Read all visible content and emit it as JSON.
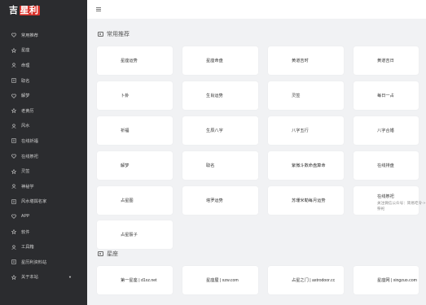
{
  "logo": {
    "text": "吉",
    "highlight": "星利"
  },
  "sidebar": {
    "items": [
      {
        "label": "常用推荐",
        "icon": "heart-icon"
      },
      {
        "label": "星座",
        "icon": "star-icon"
      },
      {
        "label": "命理",
        "icon": "user-icon"
      },
      {
        "label": "取名",
        "icon": "book-icon"
      },
      {
        "label": "解梦",
        "icon": "heart-icon"
      },
      {
        "label": "老黄历",
        "icon": "star-icon"
      },
      {
        "label": "风水",
        "icon": "user-icon"
      },
      {
        "label": "在线祈福",
        "icon": "book-icon"
      },
      {
        "label": "在线祭祀",
        "icon": "heart-icon"
      },
      {
        "label": "灵签",
        "icon": "star-icon"
      },
      {
        "label": "神秘学",
        "icon": "user-icon"
      },
      {
        "label": "风水堪舆名家",
        "icon": "book-icon"
      },
      {
        "label": "APP",
        "icon": "heart-icon"
      },
      {
        "label": "软件",
        "icon": "star-icon"
      },
      {
        "label": "工具箱",
        "icon": "user-icon"
      },
      {
        "label": "星历利资料站",
        "icon": "book-icon"
      },
      {
        "label": "关于本站",
        "icon": "star-icon",
        "caret": "▼"
      }
    ]
  },
  "sections": [
    {
      "title": "常用推荐",
      "cards": [
        {
          "title": "星座运势"
        },
        {
          "title": "星座命盘"
        },
        {
          "title": "黄道吉时"
        },
        {
          "title": "黄道吉日"
        },
        {
          "title": "卜卦"
        },
        {
          "title": "生肖运势"
        },
        {
          "title": "灵签"
        },
        {
          "title": "每日一占"
        },
        {
          "title": "祈福"
        },
        {
          "title": "生辰八字"
        },
        {
          "title": "八字五行"
        },
        {
          "title": "八字合婚"
        },
        {
          "title": "解梦"
        },
        {
          "title": "取名"
        },
        {
          "title": "紫微斗数命盘算命"
        },
        {
          "title": "在线排盘"
        },
        {
          "title": "占星图"
        },
        {
          "title": "塔罗运势"
        },
        {
          "title": "苏珊米勒每月运势"
        },
        {
          "title": "在线祭祀",
          "desc": "关注微信公众号：简易吃令->祭祀"
        },
        {
          "title": "占星骰子"
        }
      ]
    },
    {
      "title": "星座",
      "cards": [
        {
          "title": "第一星座 | d1xz.net"
        },
        {
          "title": "星座屋 | xzw.com"
        },
        {
          "title": "占星之门 | astrodoor.cc"
        },
        {
          "title": "星座网 | xingzuo.com"
        }
      ]
    }
  ]
}
